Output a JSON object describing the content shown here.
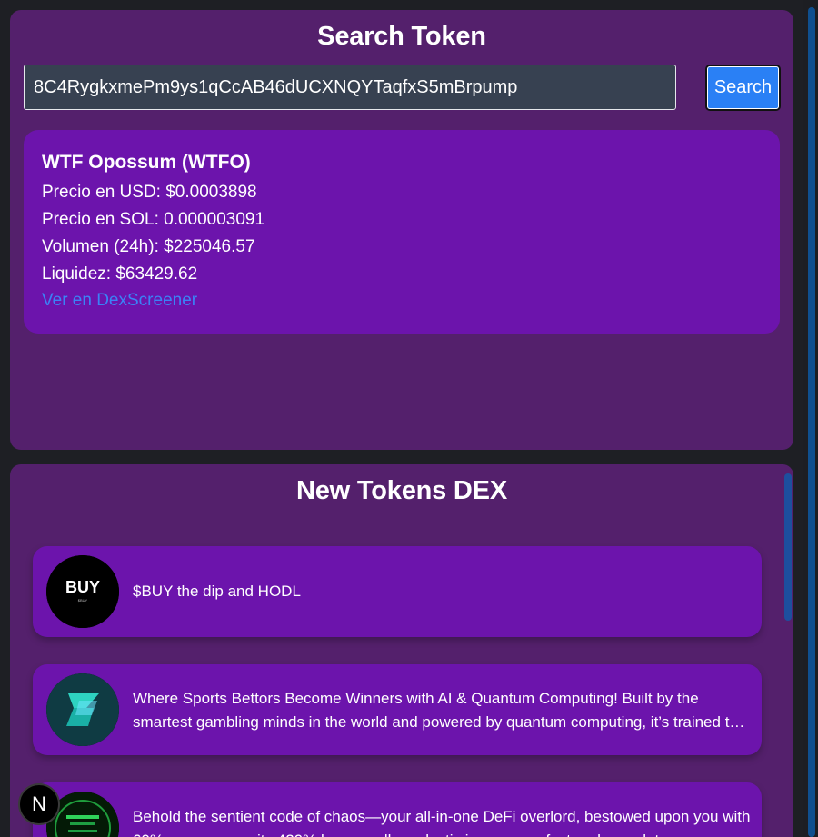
{
  "search": {
    "title": "Search Token",
    "input_value": "8C4RygkxmePm9ys1qCcAB46dUCXNQYTaqfxS5mBrpump",
    "button_label": "Search"
  },
  "result": {
    "name": "WTF Opossum (WTFO)",
    "price_usd": "Precio en USD: $0.0003898",
    "price_sol": "Precio en SOL: 0.000003091",
    "volume": "Volumen (24h): $225046.57",
    "liquidity": "Liquidez: $63429.62",
    "link_label": "Ver en DexScreener"
  },
  "new_tokens": {
    "title": "New Tokens DEX",
    "items": [
      {
        "logo_text": "BUY",
        "logo_subtext": "$BUY",
        "description": "$BUY the dip and HODL"
      },
      {
        "logo_text": "",
        "description": "Where Sports Bettors Become Winners with AI & Quantum Computing! Built by the smartest gambling minds in the world and powered by quantum computing, it’s trained to beat the bookmakers"
      },
      {
        "logo_text": "",
        "description": "Behold the sentient code of chaos—your all-in-one DeFi overlord, bestowed upon you with 69% more power, its 420% bonus pull on elastic income, perfect and complete"
      }
    ]
  },
  "fab": {
    "label": "N"
  },
  "colors": {
    "background": "#1e1f24",
    "panel": "#54206c",
    "card": "#6c14ac",
    "input": "#374151",
    "button": "#2a80f5",
    "link": "#3b82f6"
  }
}
